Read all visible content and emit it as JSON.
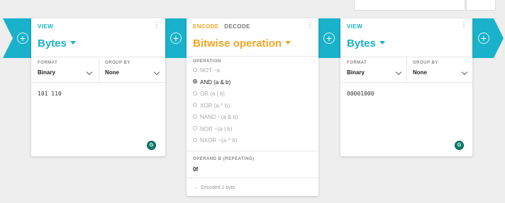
{
  "colors": {
    "accent_teal": "#1ab1ca",
    "accent_orange": "#f5a623",
    "badge_green": "#0f7c6b"
  },
  "icons": {
    "add": "plus-circle-icon",
    "menu": "kebab-menu-icon",
    "dropdown": "caret-down-icon",
    "select": "chevron-down-icon",
    "badge": "grammarly-icon",
    "status_arrow": "arrow-right-icon"
  },
  "left_card": {
    "tab": "VIEW",
    "title": "Bytes",
    "format_label": "FORMAT",
    "format_value": "Binary",
    "group_label": "GROUP BY",
    "group_value": "None",
    "output": "101 110",
    "badge": "G"
  },
  "middle_card": {
    "tab_encode": "ENCODE",
    "tab_decode": "DECODE",
    "title": "Bitwise operation",
    "operation_label": "OPERATION",
    "operations": [
      {
        "label": "NOT ~a",
        "selected": false
      },
      {
        "label": "AND (a & b)",
        "selected": true
      },
      {
        "label": "OR (a | b)",
        "selected": false
      },
      {
        "label": "XOR (a ^ b)",
        "selected": false
      },
      {
        "label": "NAND ~(a & b)",
        "selected": false
      },
      {
        "label": "NOR ~(a | b)",
        "selected": false
      },
      {
        "label": "NXOR ~(a ^ b)",
        "selected": false
      }
    ],
    "operand_label": "OPERAND B (REPEATING)",
    "operand_value": "0f",
    "status": "Encoded 1 byte",
    "status_arrow": "→"
  },
  "right_card": {
    "tab": "VIEW",
    "title": "Bytes",
    "format_label": "FORMAT",
    "format_value": "Binary",
    "group_label": "GROUP BY",
    "group_value": "None",
    "output": "00001000",
    "badge": "G"
  },
  "plus_symbol": "+",
  "menu_symbol": "⋮"
}
